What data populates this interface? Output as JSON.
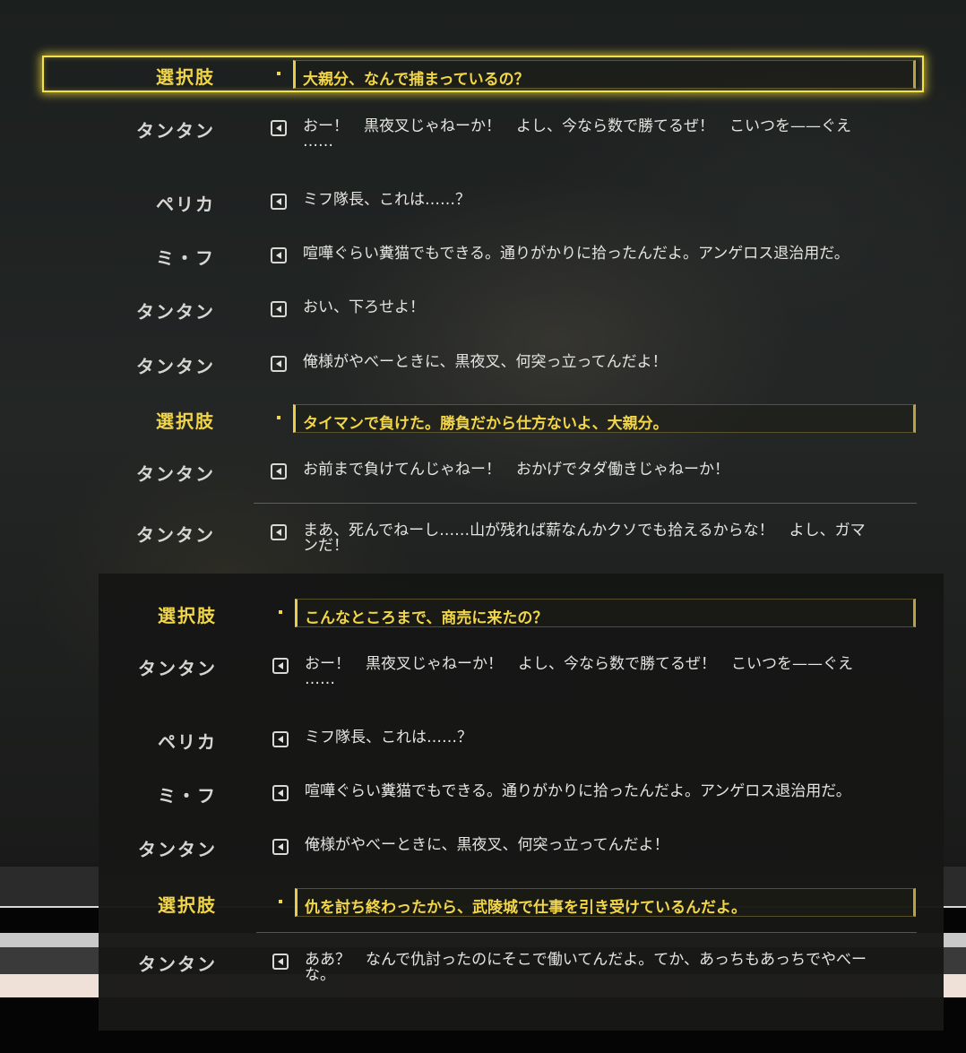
{
  "colors": {
    "accent": "#f2d64a",
    "text": "#e4e4e0",
    "speaker": "#d6d6d2"
  },
  "choice_label": "選択肢",
  "audio_icon": "speaker-play-icon",
  "rows": [
    {
      "type": "choice",
      "speaker": "選択肢",
      "text": "大親分、なんで捕まっているの？",
      "selected": true
    },
    {
      "type": "line",
      "speaker": "タンタン",
      "text": "おー！　黒夜叉じゃねーか！　よし、今なら数で勝てるぜ！　こいつを——ぐえ\n……"
    },
    {
      "type": "line",
      "speaker": "ペリカ",
      "text": "ミフ隊長、これは……？"
    },
    {
      "type": "line",
      "speaker": "ミ・フ",
      "text": "喧嘩ぐらい糞猫でもできる。通りがかりに拾ったんだよ。アンゲロス退治用だ。"
    },
    {
      "type": "line",
      "speaker": "タンタン",
      "text": "おい、下ろせよ！"
    },
    {
      "type": "line",
      "speaker": "タンタン",
      "text": "俺様がやべーときに、黒夜叉、何突っ立ってんだよ！"
    },
    {
      "type": "choice",
      "speaker": "選択肢",
      "text": "タイマンで負けた。勝負だから仕方ないよ、大親分。"
    },
    {
      "type": "line",
      "speaker": "タンタン",
      "text": "お前まで負けてんじゃねー！　おかげでタダ働きじゃねーか！"
    },
    {
      "type": "line",
      "speaker": "タンタン",
      "text": "まあ、死んでねーし……山が残れば薪なんかクソでも拾えるからな！　よし、ガマ\nンだ！"
    },
    {
      "type": "choice",
      "speaker": "選択肢",
      "text": "こんなところまで、商売に来たの？"
    },
    {
      "type": "line",
      "speaker": "タンタン",
      "text": "おー！　黒夜叉じゃねーか！　よし、今なら数で勝てるぜ！　こいつを——ぐえ\n……"
    },
    {
      "type": "line",
      "speaker": "ペリカ",
      "text": "ミフ隊長、これは……？"
    },
    {
      "type": "line",
      "speaker": "ミ・フ",
      "text": "喧嘩ぐらい糞猫でもできる。通りがかりに拾ったんだよ。アンゲロス退治用だ。"
    },
    {
      "type": "line",
      "speaker": "タンタン",
      "text": "俺様がやべーときに、黒夜叉、何突っ立ってんだよ！"
    },
    {
      "type": "choice",
      "speaker": "選択肢",
      "text": "仇を討ち終わったから、武陵城で仕事を引き受けているんだよ。"
    },
    {
      "type": "line",
      "speaker": "タンタン",
      "text": "ああ？　なんで仇討ったのにそこで働いてんだよ。てか、あっちもあっちでやべー\nな。"
    }
  ]
}
